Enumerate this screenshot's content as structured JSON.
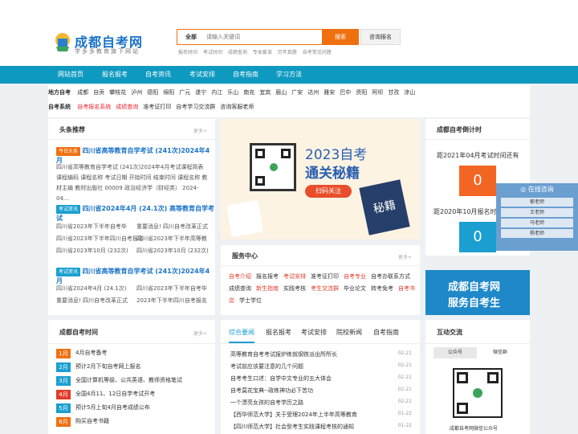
{
  "header": {
    "logo_title": "成都自考网",
    "logo_sub": "学多多教育旗下网站",
    "search_category": "全部",
    "search_placeholder": "请输入关键词",
    "search_button": "搜索",
    "consult_button": "咨询报名",
    "hot_links": [
      "报名时间",
      "考试时间",
      "成绩查询",
      "专本套读",
      "历年真题",
      "自考常见问题"
    ]
  },
  "nav": [
    "网站首页",
    "报名报考",
    "自考资讯",
    "考试安排",
    "自考指南",
    "学习方法"
  ],
  "region": {
    "area_label": "地方自考",
    "areas": [
      "成都",
      "自贡",
      "攀枝花",
      "泸州",
      "德阳",
      "绵阳",
      "广元",
      "遂宁",
      "内江",
      "乐山",
      "南充",
      "宜宾",
      "眉山",
      "广安",
      "达州",
      "雅安",
      "巴中",
      "资阳",
      "阿坝",
      "甘孜",
      "凉山"
    ],
    "system_label": "自考系统",
    "systems": [
      "自考报名系统",
      "成绩查询",
      "准考证打印",
      "自考学习交流群",
      "咨询客服老师"
    ]
  },
  "headlines": {
    "title": "头条推荐",
    "more": "更多+",
    "items": [
      {
        "tag": "今日头条",
        "tag_color": "#f07010",
        "title": "四川省高等教育自学考试 (241次)2024年4月",
        "desc": "四川省高等教育自学考试 (241次)2024年4月考试课程简表 课程编码 课程名称 考试日期 开始时间 结束时间 课程名称 教材主编 教材出版社 00009 政治经济学（财经类） 2024-04..."
      },
      {
        "tag": "考试资讯",
        "tag_color": "#1a9fd0",
        "title": "四川省2024年4月 (24.1次) 高等教育自学考试",
        "grid": [
          "四川省2023年下半年自考毕",
          "重要消息! 四川自考改革正式",
          "四川省2023年下半年四川自考报名",
          "四川省2023年下半年高等教",
          "四川省2023年10月 (232次)",
          "四川省2023年10月 (232次)"
        ]
      },
      {
        "tag": "考试资讯",
        "tag_color": "#1a9fd0",
        "title": "四川省高等教育自学考试 (241次)2024年4月",
        "grid": [
          "四川省2024年4月 (24.1次)",
          "四川省2023年下半年自考毕",
          "重要消息! 四川自考改革正式",
          "2023年下半年四川自考报名"
        ]
      }
    ]
  },
  "banner": {
    "line1": "2023自考",
    "line2": "通关秘籍",
    "button": "扫码关注",
    "book": "秘籍"
  },
  "countdown": {
    "title": "成都自考倒计时",
    "line1": "距2021年04月考试时间还有",
    "value1": "0",
    "line2": "距2020年10月报名时",
    "value2": "0"
  },
  "floating": {
    "title": "在线咨询",
    "agents": [
      "郁老师",
      "王老师",
      "马老师",
      "杨老师"
    ]
  },
  "service": {
    "title": "服务中心",
    "more": "更多+",
    "links": [
      {
        "text": "自考介绍",
        "red": true
      },
      {
        "text": "报名报考",
        "red": false
      },
      {
        "text": "考试安排",
        "red": true
      },
      {
        "text": "准考证打印",
        "red": false
      },
      {
        "text": "自考专业",
        "red": true
      },
      {
        "text": "自考办联系方式",
        "red": false
      },
      {
        "text": "成绩查询",
        "red": false
      },
      {
        "text": "新生指南",
        "red": true
      },
      {
        "text": "实践考核",
        "red": false
      },
      {
        "text": "考生交流群",
        "red": true
      },
      {
        "text": "毕业论文",
        "red": false
      },
      {
        "text": "转考免考",
        "red": false
      },
      {
        "text": "自考书店",
        "red": true
      },
      {
        "text": "学士学位",
        "red": false
      }
    ]
  },
  "promo": {
    "line1": "成都自考网",
    "line2": "服务自考生"
  },
  "exam_time": {
    "title": "成都自考时间",
    "more": "更多+",
    "items": [
      {
        "month": "1月",
        "text": "4月自考备考",
        "color": "#f07010"
      },
      {
        "month": "2月",
        "text": "预计2月下旬自考网上报名",
        "color": "#1a9fd0"
      },
      {
        "month": "3月",
        "text": "全国计算机等级、公共英语、教师资格笔试",
        "color": "#1a9fd0"
      },
      {
        "month": "4月",
        "text": "全国4月11、12日自学考试开考",
        "color": "#e23a2a"
      },
      {
        "month": "5月",
        "text": "预计5月上旬4月自考成绩公布",
        "color": "#1a9fd0"
      },
      {
        "month": "6月",
        "text": "购买自考书籍",
        "color": "#f07010"
      }
    ]
  },
  "news": {
    "tabs": [
      "综合要闻",
      "报名报考",
      "考试安排",
      "院校新闻",
      "自考指南"
    ],
    "items": [
      {
        "title": "高等教育自考考试报炉练就钢铁派出所所长",
        "date": "02-21"
      },
      {
        "title": "考试前应该要注意的几个问题",
        "date": "02-21"
      },
      {
        "title": "自考考生口述：自学中文专业的五大体会",
        "date": "02-21"
      },
      {
        "title": "自考莫花宝典--政练神功必下苦功",
        "date": "02-21"
      },
      {
        "title": "一个漂亮女孩的自考学历之路",
        "date": "02-21"
      },
      {
        "title": "【西华师范大学】关于受理2024年上半年高等教育",
        "date": "01-22"
      },
      {
        "title": "【四川师范大学】社会型考生实践课程考核的通知",
        "date": "01-22"
      }
    ]
  },
  "exchange": {
    "title": "互动交流",
    "tabs": [
      "公众号",
      "微信群"
    ],
    "caption": "成都自考网微信公众号"
  }
}
